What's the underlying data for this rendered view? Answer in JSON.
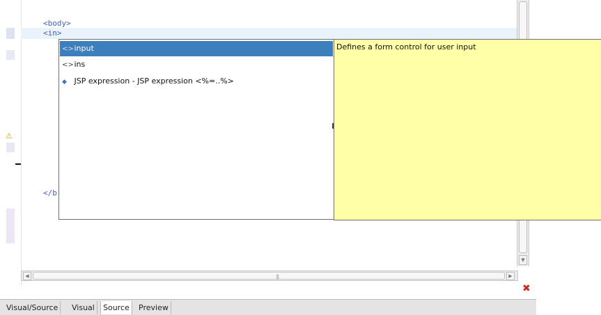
{
  "editor": {
    "lines": [
      "<body>",
      "<in>",
      "</b"
    ]
  },
  "autocomplete": {
    "items": [
      {
        "icon": "tag-icon",
        "label": "input"
      },
      {
        "icon": "tag-icon",
        "label": "ins"
      },
      {
        "icon": "jsp-expression-icon",
        "label": "JSP expression - JSP expression <%=..%>"
      }
    ],
    "selected_index": 0,
    "documentation": "Defines a form control for user input"
  },
  "tabs": [
    "Visual/Source",
    "Visual",
    "Source",
    "Preview"
  ],
  "active_tab": "Source",
  "colors": {
    "selection": "#3d7ebd",
    "doc_background": "#ffffa8",
    "code_tag": "#3f5fbf",
    "error": "#d9261c"
  }
}
